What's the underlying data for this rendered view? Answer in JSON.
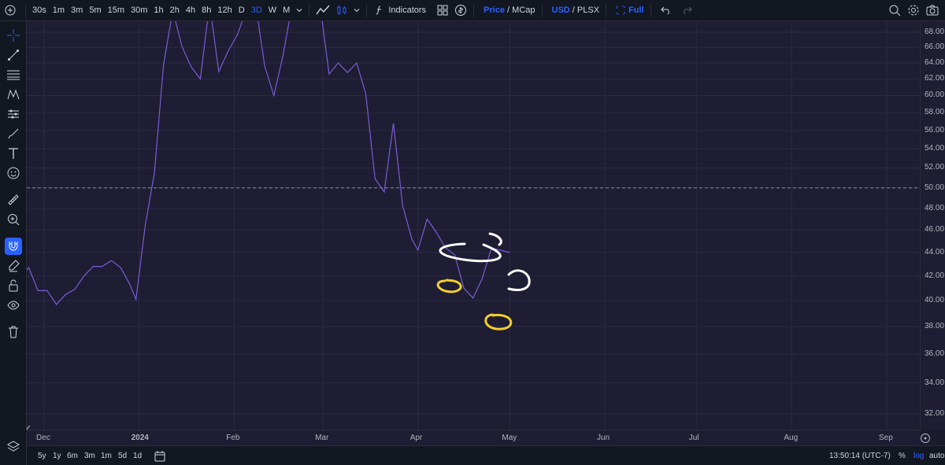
{
  "toolbar": {
    "intervals": [
      "30s",
      "1m",
      "3m",
      "5m",
      "15m",
      "30m",
      "1h",
      "2h",
      "4h",
      "8h",
      "12h",
      "D",
      "3D",
      "W",
      "M"
    ],
    "active_interval": "3D",
    "indicators_label": "Indicators",
    "price_label": "Price",
    "slash": "/",
    "mcap_label": "MCap",
    "usd_label": "USD",
    "plsx_label": "PLSX",
    "full_label": "Full"
  },
  "axis": {
    "y_ticks": [
      "68.00",
      "66.00",
      "64.00",
      "62.00",
      "60.00",
      "58.00",
      "56.00",
      "54.00",
      "52.00",
      "50.00",
      "48.00",
      "46.00",
      "44.00",
      "42.00",
      "40.00",
      "38.00",
      "36.00",
      "34.00",
      "32.00"
    ],
    "x_ticks": [
      "Dec",
      "2024",
      "Feb",
      "Mar",
      "Apr",
      "May",
      "Jun",
      "Jul",
      "Aug",
      "Sep"
    ]
  },
  "footer": {
    "ranges": [
      "5y",
      "1y",
      "6m",
      "3m",
      "1m",
      "5d",
      "1d"
    ],
    "time": "13:50:14 (UTC-7)",
    "percent": "%",
    "log": "log",
    "auto": "auto"
  },
  "colors": {
    "line": "#7b5cd6",
    "annotation_white": "#ffffff",
    "annotation_yellow": "#f2cf2c",
    "accent": "#2962ff"
  },
  "chart_data": {
    "type": "line",
    "y_axis": "log",
    "ylim": [
      31.0,
      69.5
    ],
    "reference_line": 50.0,
    "x": [
      "2023-11-24",
      "2023-11-26",
      "2023-11-29",
      "2023-12-02",
      "2023-12-05",
      "2023-12-08",
      "2023-12-11",
      "2023-12-14",
      "2023-12-17",
      "2023-12-20",
      "2023-12-23",
      "2023-12-26",
      "2023-12-29",
      "2023-12-31",
      "2024-01-03",
      "2024-01-06",
      "2024-01-09",
      "2024-01-12",
      "2024-01-15",
      "2024-01-18",
      "2024-01-21",
      "2024-01-24",
      "2024-01-27",
      "2024-01-30",
      "2024-02-02",
      "2024-02-05",
      "2024-02-08",
      "2024-02-11",
      "2024-02-14",
      "2024-02-17",
      "2024-02-20",
      "2024-02-23",
      "2024-02-26",
      "2024-02-29",
      "2024-03-03",
      "2024-03-06",
      "2024-03-09",
      "2024-03-12",
      "2024-03-15",
      "2024-03-18",
      "2024-03-21",
      "2024-03-24",
      "2024-03-27",
      "2024-03-30",
      "2024-04-01",
      "2024-04-04",
      "2024-04-07",
      "2024-04-10",
      "2024-04-13",
      "2024-04-16",
      "2024-04-19",
      "2024-04-22",
      "2024-04-25",
      "2024-04-28",
      "2024-05-01"
    ],
    "values": [
      42.1,
      42.7,
      40.8,
      40.8,
      39.7,
      40.5,
      40.9,
      42.0,
      42.8,
      42.8,
      43.3,
      42.7,
      41.3,
      40.1,
      46.4,
      51.5,
      63.8,
      71.0,
      66.1,
      63.5,
      62.0,
      72.0,
      62.9,
      65.5,
      67.6,
      71.0,
      72.0,
      63.6,
      60.0,
      65.0,
      72.0,
      72.0,
      72.0,
      72.0,
      62.6,
      64.0,
      62.8,
      64.0,
      60.2,
      50.9,
      49.6,
      56.8,
      48.3,
      45.2,
      44.2,
      47.0,
      45.8,
      44.4,
      43.8,
      41.0,
      40.2,
      41.8,
      44.4,
      44.2,
      44.0
    ]
  }
}
